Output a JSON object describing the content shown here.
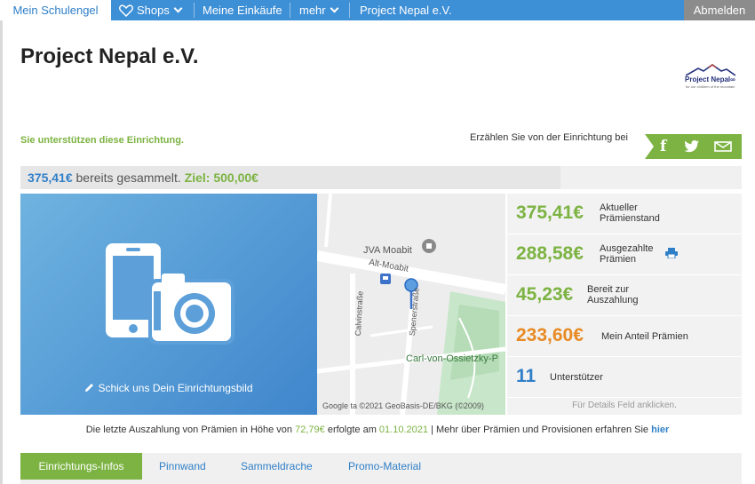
{
  "nav": {
    "active": "Mein Schulengel",
    "shops": "Shops",
    "purchases": "Meine Einkäufe",
    "more": "mehr",
    "org": "Project Nepal e.V.",
    "logout": "Abmelden"
  },
  "page": {
    "title": "Project Nepal e.V.",
    "logo_text": "Project Nepal∞",
    "logo_subtext": "for our children of the mountain"
  },
  "support": {
    "text": "Sie unterstützen diese Einrichtung.",
    "tell": "Erzählen Sie von der Einrichtung bei"
  },
  "progress": {
    "collected": "375,41€",
    "collected_text": "bereits gesammelt.",
    "goal": "Ziel: 500,00€",
    "value": 375.41,
    "target": 500.0
  },
  "photo": {
    "caption": "Schick uns Dein Einrichtungsbild"
  },
  "map": {
    "poi": "JVA Moabit",
    "street1": "Alt-Moabit",
    "street2": "Calvinstraße",
    "street3": "Spenerstraße",
    "park": "Carl-von-Ossietzky-P",
    "copyright": "Google  ta ©2021 GeoBasis-DE/BKG (©2009)"
  },
  "stats": [
    {
      "value": "375,41€",
      "label1": "Aktueller",
      "label2": "Prämienstand",
      "color": "#7cb342"
    },
    {
      "value": "288,58€",
      "label1": "Ausgezahlte",
      "label2": "Prämien",
      "color": "#7cb342"
    },
    {
      "value": "45,23€",
      "label1": "Bereit zur",
      "label2": "Auszahlung",
      "color": "#7cb342"
    },
    {
      "value": "233,60€",
      "label1": "Mein Anteil Prämien",
      "label2": "",
      "color": "#e88a24"
    },
    {
      "value": "11",
      "label1": "Unterstützer",
      "label2": "",
      "color": "#2f7fc8"
    }
  ],
  "details_hint": "Für Details Feld anklicken.",
  "payout": {
    "part1": "Die letzte Auszahlung von Prämien in Höhe von",
    "amount": "72,79€",
    "part2": "erfolgte am",
    "date": "01.10.2021",
    "part3": "| Mehr über Prämien und Provisionen erfahren Sie",
    "link": "hier"
  },
  "tabs": [
    "Einrichtungs-Infos",
    "Pinnwand",
    "Sammeldrache",
    "Promo-Material"
  ],
  "colors": {
    "blue": "#3d8fd6",
    "green": "#7cb342",
    "orange": "#e88a24"
  }
}
